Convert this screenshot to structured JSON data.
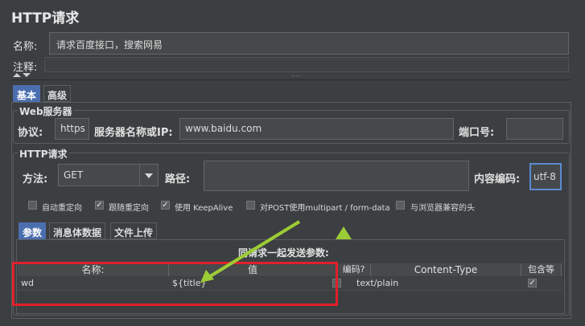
{
  "panel": {
    "title": "HTTP请求"
  },
  "name_row": {
    "label": "名称:",
    "value": "请求百度接口，搜索网易"
  },
  "comment_row": {
    "label": "注释:",
    "value": ""
  },
  "splitter": {
    "grip": "....."
  },
  "main_tabs": [
    {
      "label": "基本"
    },
    {
      "label": "高级"
    }
  ],
  "web_server": {
    "legend": "Web服务器",
    "protocol_label": "协议:",
    "protocol_value": "https",
    "server_label": "服务器名称或IP:",
    "server_value": "www.baidu.com",
    "port_label": "端口号:",
    "port_value": ""
  },
  "http_request": {
    "legend": "HTTP请求",
    "method_label": "方法:",
    "method_value": "GET",
    "path_label": "路径:",
    "path_value": "",
    "encoding_label": "内容编码:",
    "encoding_value": "utf-8"
  },
  "options": [
    {
      "label": "自动重定向",
      "checked": false
    },
    {
      "label": "跟随重定向",
      "checked": true
    },
    {
      "label": "使用 KeepAlive",
      "checked": true
    },
    {
      "label": "对POST使用multipart / form-data",
      "checked": false
    },
    {
      "label": "与浏览器兼容的头",
      "checked": false
    }
  ],
  "sub_tabs": [
    {
      "label": "参数"
    },
    {
      "label": "消息体数据"
    },
    {
      "label": "文件上传"
    }
  ],
  "params_table": {
    "caption": "同请求一起发送参数:",
    "columns": [
      "名称:",
      "值",
      "编码?",
      "Content-Type",
      "包含等于?"
    ],
    "rows": [
      {
        "name": "wd",
        "value": "${title}",
        "encode": false,
        "content_type": "text/plain",
        "include_equals": true
      }
    ]
  },
  "colors": {
    "background": "#3c3f41",
    "field": "#45494a",
    "accent": "#4b6eaf",
    "highlight_box": "#e0202a",
    "arrow": "#9ccc35"
  }
}
